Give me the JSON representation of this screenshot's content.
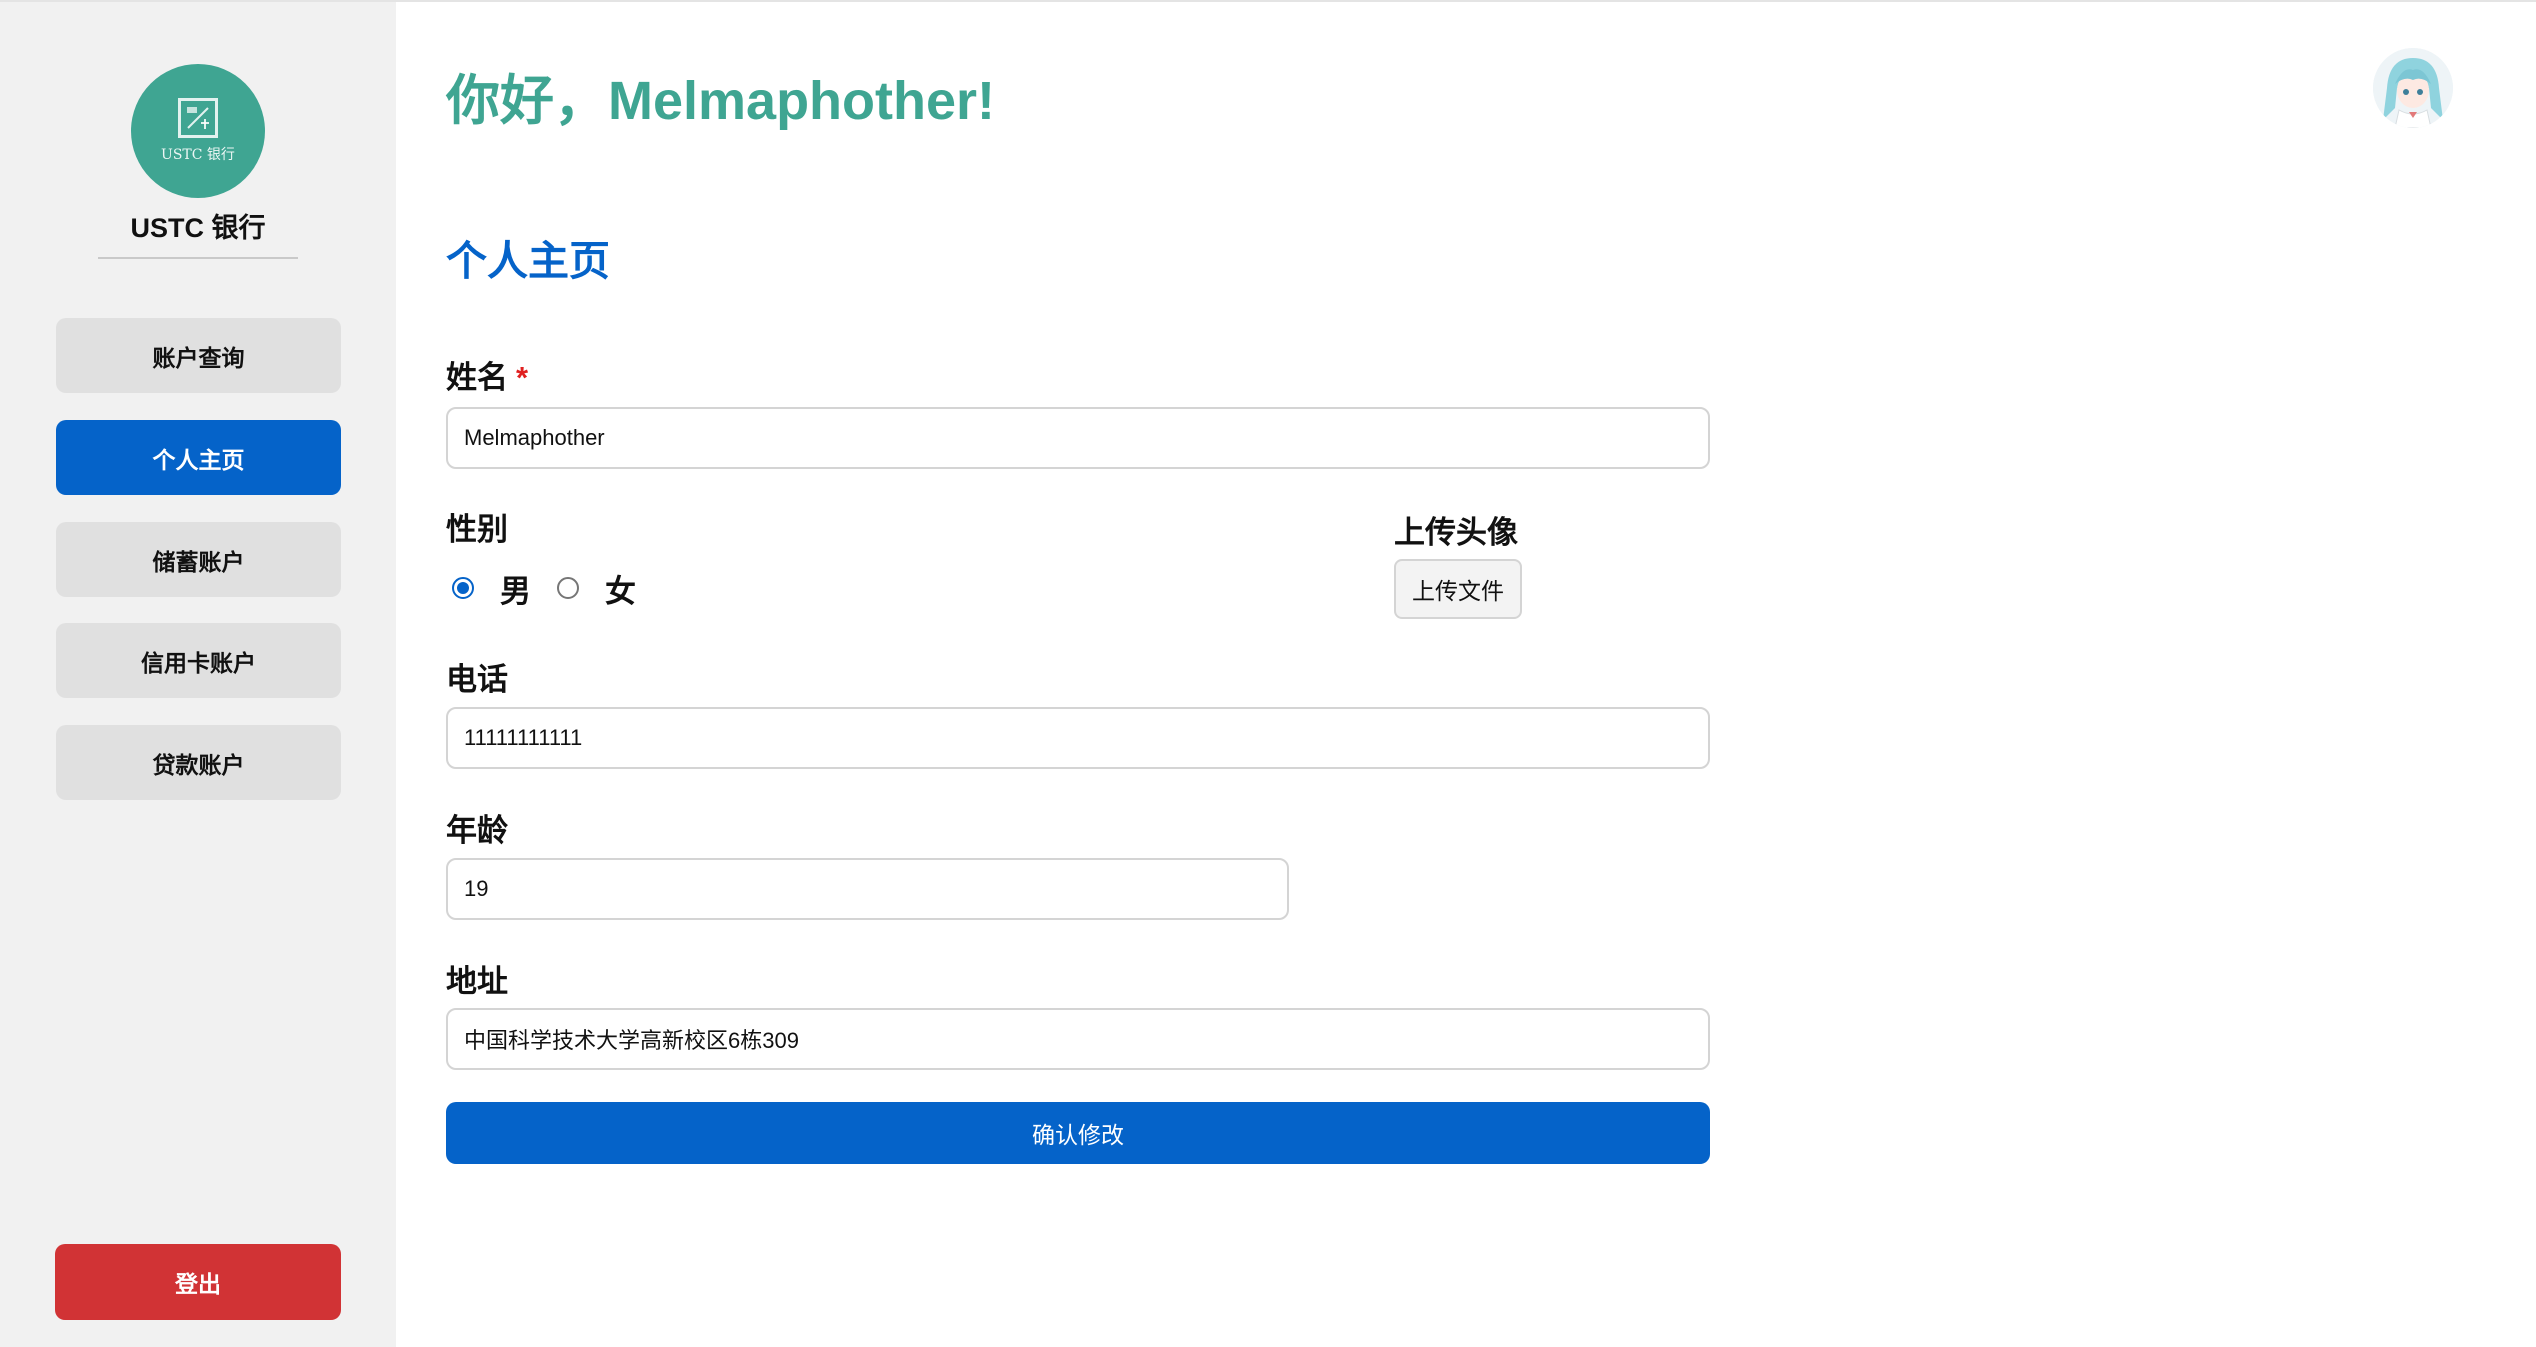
{
  "sidebar": {
    "logo_text": "USTC 银行",
    "brand_name": "USTC 银行",
    "items": [
      {
        "label": "账户查询",
        "active": false
      },
      {
        "label": "个人主页",
        "active": true
      },
      {
        "label": "储蓄账户",
        "active": false
      },
      {
        "label": "信用卡账户",
        "active": false
      },
      {
        "label": "贷款账户",
        "active": false
      }
    ],
    "logout_label": "登出"
  },
  "header": {
    "greeting": "你好，Melmaphother!",
    "avatar_icon": "anime-avatar-icon"
  },
  "main": {
    "page_title": "个人主页",
    "form": {
      "name_label": "姓名",
      "name_required_mark": "*",
      "name_value": "Melmaphother",
      "gender_label": "性别",
      "gender_options": [
        "男",
        "女"
      ],
      "gender_selected": "男",
      "avatar_upload_label": "上传头像",
      "upload_button_label": "上传文件",
      "phone_label": "电话",
      "phone_value": "11111111111",
      "age_label": "年龄",
      "age_value": "19",
      "address_label": "地址",
      "address_value": "中国科学技术大学高新校区6栋309",
      "submit_label": "确认修改"
    }
  },
  "colors": {
    "accent_teal": "#3fa592",
    "primary_blue": "#0563c9",
    "danger_red": "#d13335",
    "sidebar_bg": "#f1f1f1",
    "nav_bg": "#e0e0e0"
  }
}
